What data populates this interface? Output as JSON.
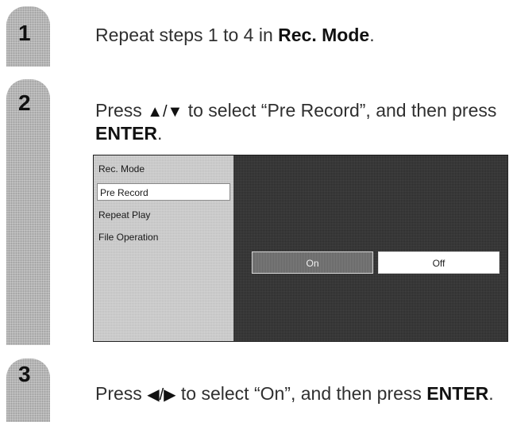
{
  "steps": [
    {
      "number": "1",
      "text_prefix": "Repeat steps 1 to 4 in ",
      "text_bold": "Rec. Mode",
      "text_suffix": "."
    },
    {
      "number": "2",
      "text_prefix": "Press ",
      "arrows": "▲/▼",
      "text_middle": " to select “Pre Record”, and then press ",
      "text_bold": "ENTER",
      "text_suffix": "."
    },
    {
      "number": "3",
      "text_prefix": "Press ",
      "arrows": "◀/▶",
      "text_middle": " to select “On”, and then press ",
      "text_bold": "ENTER",
      "text_suffix": "."
    }
  ],
  "menu": {
    "items": [
      "Rec. Mode",
      "Pre Record",
      "Repeat Play",
      "File Operation"
    ],
    "selected_item": "Pre Record"
  },
  "options": {
    "on_label": "On",
    "off_label": "Off",
    "highlighted": "On"
  }
}
